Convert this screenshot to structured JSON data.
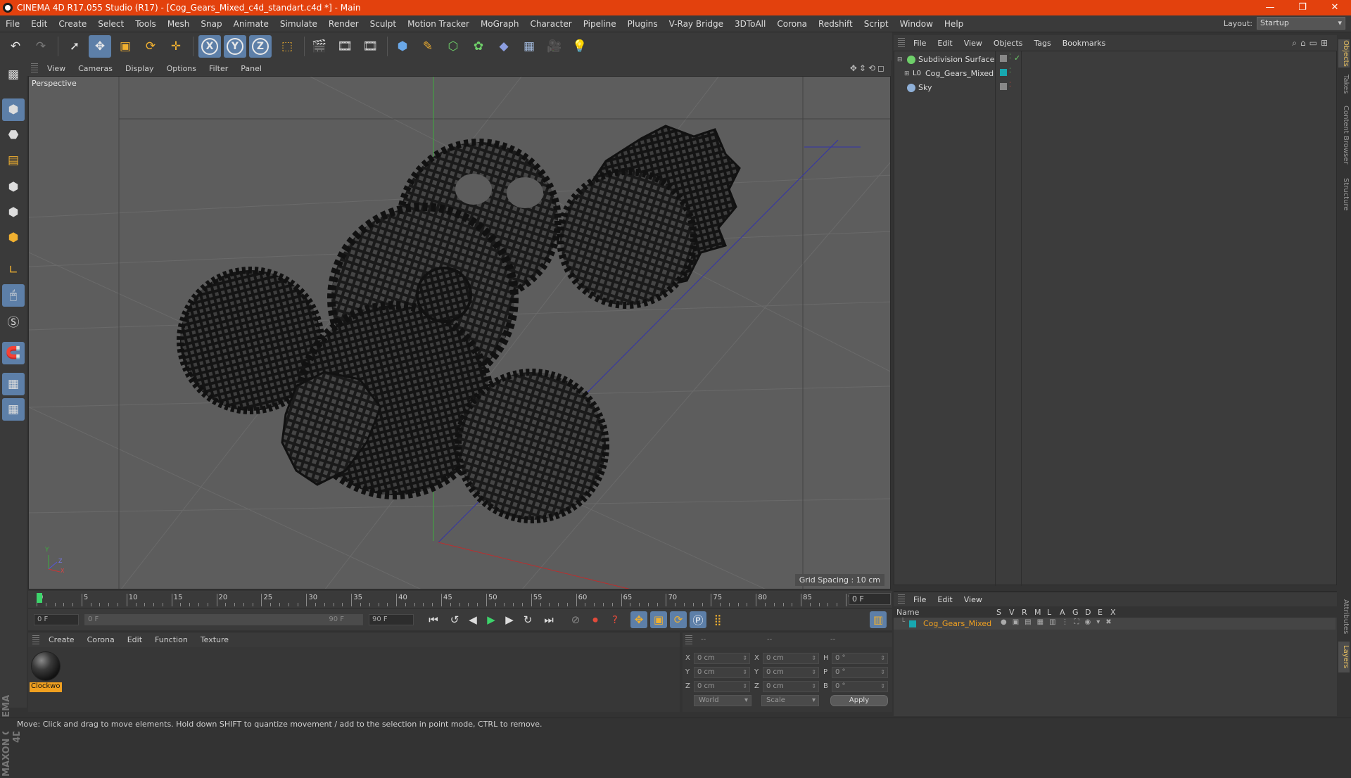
{
  "window": {
    "title": "CINEMA 4D R17.055 Studio (R17) - [Cog_Gears_Mixed_c4d_standart.c4d *] - Main",
    "minimize": "—",
    "maximize": "❐",
    "close": "✕"
  },
  "menubar": {
    "items": [
      "File",
      "Edit",
      "Create",
      "Select",
      "Tools",
      "Mesh",
      "Snap",
      "Animate",
      "Simulate",
      "Render",
      "Sculpt",
      "Motion Tracker",
      "MoGraph",
      "Character",
      "Pipeline",
      "Plugins",
      "V-Ray Bridge",
      "3DToAll",
      "Corona",
      "Redshift",
      "Script",
      "Window",
      "Help"
    ],
    "layout_label": "Layout:",
    "layout_value": "Startup"
  },
  "toolbar": {
    "axis_x": "X",
    "axis_y": "Y",
    "axis_z": "Z"
  },
  "viewport": {
    "menu": [
      "View",
      "Cameras",
      "Display",
      "Options",
      "Filter",
      "Panel"
    ],
    "label": "Perspective",
    "grid_spacing": "Grid Spacing : 10 cm",
    "axis_y": "Y",
    "axis_z": "Z",
    "axis_x": "X"
  },
  "timeline": {
    "ticks": [
      "0",
      "5",
      "10",
      "15",
      "20",
      "25",
      "30",
      "35",
      "40",
      "45",
      "50",
      "55",
      "60",
      "65",
      "70",
      "75",
      "80",
      "85",
      "90"
    ],
    "current_frame": "0 F"
  },
  "transport": {
    "start_field": "0 F",
    "slider_start": "0 F",
    "slider_end": "90 F",
    "end_field": "90 F"
  },
  "material_manager": {
    "menu": [
      "Create",
      "Corona",
      "Edit",
      "Function",
      "Texture"
    ],
    "material_name": "Clockwo"
  },
  "coordinates": {
    "headers": [
      "--",
      "--",
      "--"
    ],
    "rows": [
      {
        "l1": "X",
        "v1": "0 cm",
        "l2": "X",
        "v2": "0 cm",
        "l3": "H",
        "v3": "0 °"
      },
      {
        "l1": "Y",
        "v1": "0 cm",
        "l2": "Y",
        "v2": "0 cm",
        "l3": "P",
        "v3": "0 °"
      },
      {
        "l1": "Z",
        "v1": "0 cm",
        "l2": "Z",
        "v2": "0 cm",
        "l3": "B",
        "v3": "0 °"
      }
    ],
    "mode_world": "World",
    "mode_scale": "Scale",
    "apply": "Apply"
  },
  "status_bar": {
    "text": "Move: Click and drag to move elements. Hold down SHIFT to quantize movement / add to the selection in point mode, CTRL to remove."
  },
  "object_manager": {
    "menu": [
      "File",
      "Edit",
      "View",
      "Objects",
      "Tags",
      "Bookmarks"
    ],
    "objects": [
      {
        "name": "Subdivision Surface"
      },
      {
        "name": "Cog_Gears_Mixed"
      },
      {
        "name": "Sky"
      }
    ]
  },
  "layer_manager": {
    "menu": [
      "File",
      "Edit",
      "View"
    ],
    "columns": [
      "Name",
      "S",
      "V",
      "R",
      "M",
      "L",
      "A",
      "G",
      "D",
      "E",
      "X"
    ],
    "layers": [
      {
        "name": "Cog_Gears_Mixed"
      }
    ]
  },
  "right_tabs": [
    "Objects",
    "Takes",
    "Content Browser",
    "Structure",
    "Attributes",
    "Layers"
  ],
  "brand": "MAXON CINEMA 4D",
  "colors": {
    "titlebar": "#e3410d",
    "accent": "#5d7fa8",
    "selection": "#f0a020",
    "layer_teal": "#18a8b0"
  }
}
